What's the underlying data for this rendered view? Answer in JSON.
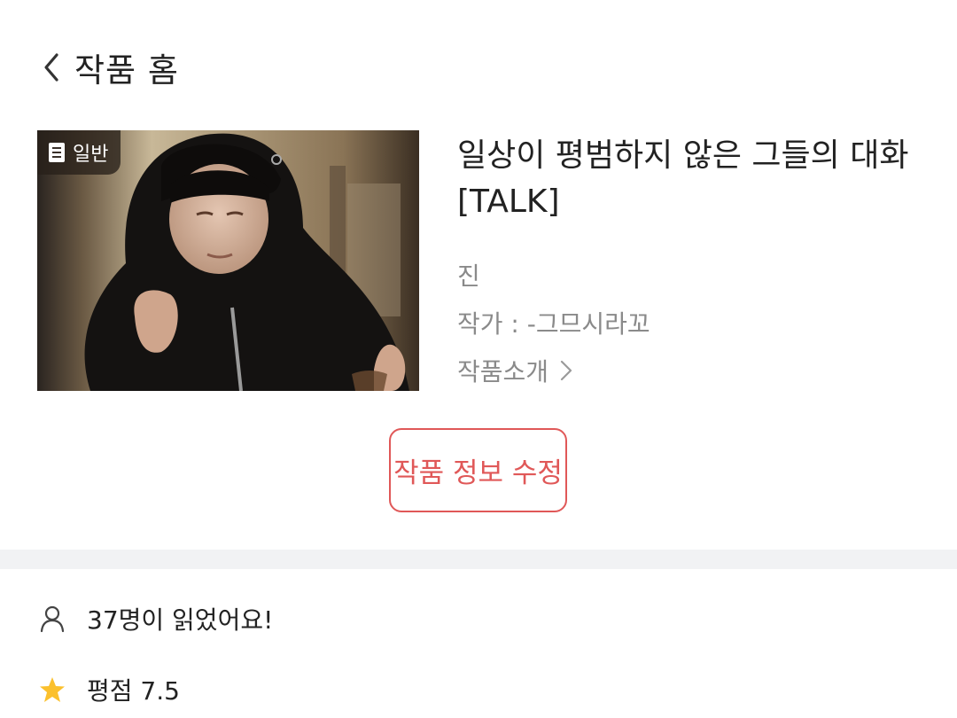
{
  "header": {
    "back_icon": "chevron-left-icon",
    "back_label": "작품 홈"
  },
  "work": {
    "genre_icon": "document-icon",
    "genre_badge": "일반",
    "title_line1": "일상이 평범하지 않은 그들의 대화",
    "title_line2": "[TALK]",
    "sub_name": "진",
    "author": "작가 : -그므시라꼬",
    "intro_label": "작품소개",
    "intro_icon": "chevron-right-icon"
  },
  "actions": {
    "edit_label": "작품 정보 수정"
  },
  "stats": {
    "readers_icon": "person-icon",
    "readers": "37명이 읽었어요!",
    "rating_icon": "star-icon",
    "rating": "평점 7.5"
  },
  "colors": {
    "accent": "#e05858",
    "muted_text": "#8a8a8a",
    "divider": "#f1f2f4",
    "star": "#fbc02d"
  }
}
